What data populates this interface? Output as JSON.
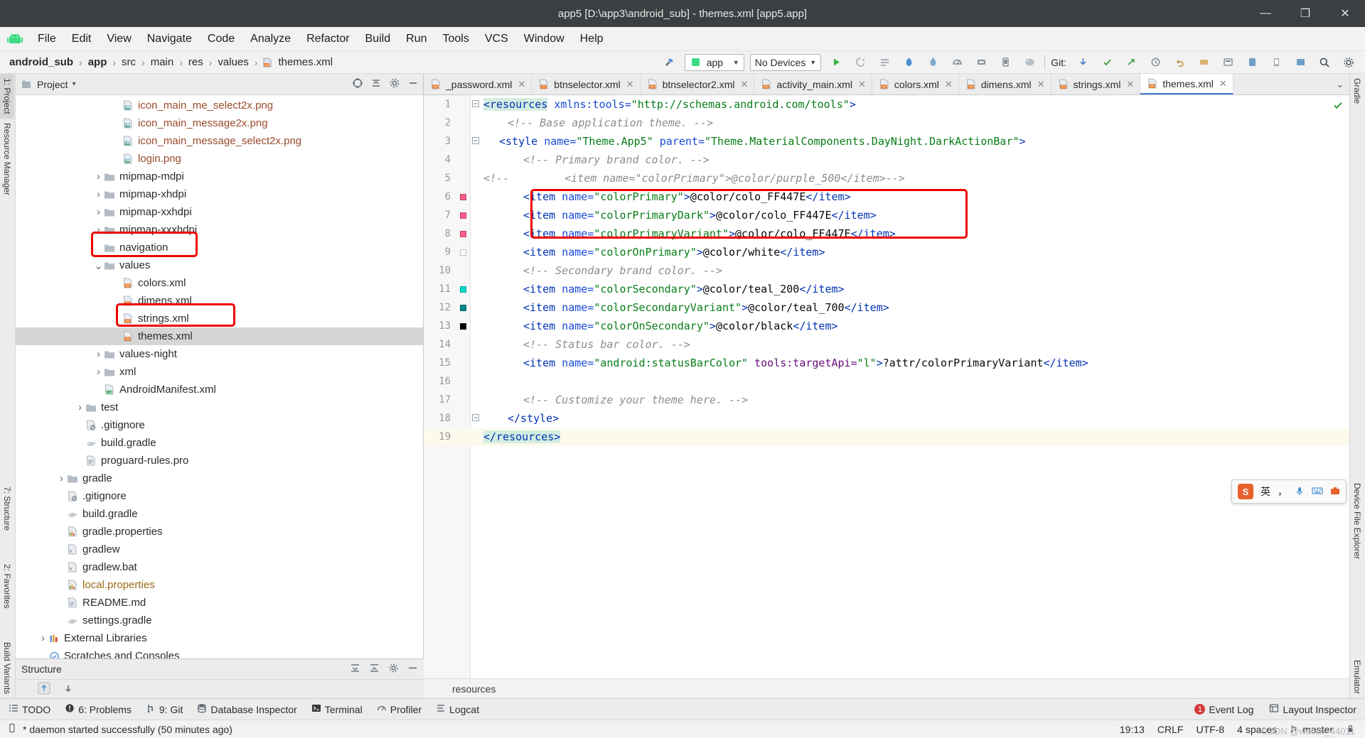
{
  "window": {
    "title": "app5 [D:\\app3\\android_sub] - themes.xml [app5.app]",
    "minimize": "—",
    "maximize": "❐",
    "close": "✕"
  },
  "menubar": {
    "logo": "android-logo-icon",
    "items": [
      "File",
      "Edit",
      "View",
      "Navigate",
      "Code",
      "Analyze",
      "Refactor",
      "Build",
      "Run",
      "Tools",
      "VCS",
      "Window",
      "Help"
    ]
  },
  "navbar": {
    "crumbs": [
      "android_sub",
      "app",
      "src",
      "main",
      "res",
      "values",
      "themes.xml"
    ],
    "separator": "›",
    "module_selector": "app",
    "device_selector": "No Devices",
    "git_label": "Git:",
    "run_icon": "run-icon",
    "debug_icon": "debug-icon",
    "search_icon": "search-icon"
  },
  "left_rail": {
    "items": [
      "1: Project",
      "Resource Manager"
    ],
    "bottom_items": [
      "7: Structure",
      "2: Favorites",
      "Build Variants"
    ]
  },
  "right_rail": {
    "items": [
      "Gradle",
      "Device File Explorer",
      "Emulator"
    ]
  },
  "project_panel": {
    "title": "Project",
    "caret": "▾",
    "icons": [
      "target-icon",
      "collapse-all-icon",
      "settings-icon",
      "hide-icon"
    ],
    "tree": [
      {
        "indent": 5,
        "arrow": "",
        "icon": "png-file-icon",
        "label": "icon_main_me_select2x.png",
        "style": "png",
        "selected": false
      },
      {
        "indent": 5,
        "arrow": "",
        "icon": "png-file-icon",
        "label": "icon_main_message2x.png",
        "style": "png",
        "selected": false
      },
      {
        "indent": 5,
        "arrow": "",
        "icon": "png-file-icon",
        "label": "icon_main_message_select2x.png",
        "style": "png",
        "selected": false
      },
      {
        "indent": 5,
        "arrow": "",
        "icon": "png-file-icon",
        "label": "login.png",
        "style": "png",
        "selected": false
      },
      {
        "indent": 4,
        "arrow": "›",
        "icon": "folder-icon",
        "label": "mipmap-mdpi",
        "style": "",
        "selected": false
      },
      {
        "indent": 4,
        "arrow": "›",
        "icon": "folder-icon",
        "label": "mipmap-xhdpi",
        "style": "",
        "selected": false
      },
      {
        "indent": 4,
        "arrow": "›",
        "icon": "folder-icon",
        "label": "mipmap-xxhdpi",
        "style": "",
        "selected": false
      },
      {
        "indent": 4,
        "arrow": "›",
        "icon": "folder-icon",
        "label": "mipmap-xxxhdpi",
        "style": "",
        "selected": false
      },
      {
        "indent": 4,
        "arrow": "",
        "icon": "folder-icon",
        "label": "navigation",
        "style": "",
        "selected": false
      },
      {
        "indent": 4,
        "arrow": "∨",
        "icon": "folder-icon",
        "label": "values",
        "style": "",
        "selected": false
      },
      {
        "indent": 5,
        "arrow": "",
        "icon": "xml-file-icon",
        "label": "colors.xml",
        "style": "",
        "selected": false
      },
      {
        "indent": 5,
        "arrow": "",
        "icon": "xml-file-icon",
        "label": "dimens.xml",
        "style": "",
        "selected": false
      },
      {
        "indent": 5,
        "arrow": "",
        "icon": "xml-file-icon",
        "label": "strings.xml",
        "style": "",
        "selected": false
      },
      {
        "indent": 5,
        "arrow": "",
        "icon": "xml-file-icon",
        "label": "themes.xml",
        "style": "",
        "selected": true
      },
      {
        "indent": 4,
        "arrow": "›",
        "icon": "folder-icon",
        "label": "values-night",
        "style": "",
        "selected": false
      },
      {
        "indent": 4,
        "arrow": "›",
        "icon": "folder-icon",
        "label": "xml",
        "style": "",
        "selected": false
      },
      {
        "indent": 4,
        "arrow": "",
        "icon": "manifest-file-icon",
        "label": "AndroidManifest.xml",
        "style": "",
        "selected": false
      },
      {
        "indent": 3,
        "arrow": "›",
        "icon": "folder-icon",
        "label": "test",
        "style": "",
        "selected": false
      },
      {
        "indent": 3,
        "arrow": "",
        "icon": "gitignore-icon",
        "label": ".gitignore",
        "style": "",
        "selected": false
      },
      {
        "indent": 3,
        "arrow": "",
        "icon": "gradle-file-icon",
        "label": "build.gradle",
        "style": "",
        "selected": false
      },
      {
        "indent": 3,
        "arrow": "",
        "icon": "pro-file-icon",
        "label": "proguard-rules.pro",
        "style": "",
        "selected": false
      },
      {
        "indent": 2,
        "arrow": "›",
        "icon": "folder-icon",
        "label": "gradle",
        "style": "",
        "selected": false
      },
      {
        "indent": 2,
        "arrow": "",
        "icon": "gitignore-icon",
        "label": ".gitignore",
        "style": "",
        "selected": false
      },
      {
        "indent": 2,
        "arrow": "",
        "icon": "gradle-file-icon",
        "label": "build.gradle",
        "style": "",
        "selected": false
      },
      {
        "indent": 2,
        "arrow": "",
        "icon": "properties-icon",
        "label": "gradle.properties",
        "style": "",
        "selected": false
      },
      {
        "indent": 2,
        "arrow": "",
        "icon": "script-file-icon",
        "label": "gradlew",
        "style": "",
        "selected": false
      },
      {
        "indent": 2,
        "arrow": "",
        "icon": "script-file-icon",
        "label": "gradlew.bat",
        "style": "",
        "selected": false
      },
      {
        "indent": 2,
        "arrow": "",
        "icon": "properties-icon",
        "label": "local.properties",
        "style": "prop",
        "selected": false
      },
      {
        "indent": 2,
        "arrow": "",
        "icon": "md-file-icon",
        "label": "README.md",
        "style": "",
        "selected": false
      },
      {
        "indent": 2,
        "arrow": "",
        "icon": "gradle-file-icon",
        "label": "settings.gradle",
        "style": "",
        "selected": false
      },
      {
        "indent": 1,
        "arrow": "›",
        "icon": "library-icon",
        "label": "External Libraries",
        "style": "",
        "selected": false
      },
      {
        "indent": 1,
        "arrow": "",
        "icon": "scratch-icon",
        "label": "Scratches and Consoles",
        "style": "",
        "selected": false
      }
    ]
  },
  "structure_panel": {
    "title": "Structure",
    "icons": [
      "expand-all-icon",
      "collapse-all-icon",
      "settings-icon",
      "hide-icon"
    ],
    "body_icons": [
      "sort-up-icon",
      "sort-down-icon"
    ]
  },
  "editor": {
    "tabs": [
      {
        "label": "_password.xml",
        "active": false
      },
      {
        "label": "btnselector.xml",
        "active": false
      },
      {
        "label": "btnselector2.xml",
        "active": false
      },
      {
        "label": "activity_main.xml",
        "active": false
      },
      {
        "label": "colors.xml",
        "active": false
      },
      {
        "label": "dimens.xml",
        "active": false
      },
      {
        "label": "strings.xml",
        "active": false
      },
      {
        "label": "themes.xml",
        "active": true
      }
    ],
    "tab_close": "✕",
    "tabs_overflow": "⌄",
    "breadcrumb_bottom": "resources",
    "inspection_ok": "✓",
    "lines": [
      {
        "n": 1,
        "marker": "",
        "fold": "−",
        "highlight": false
      },
      {
        "n": 2,
        "marker": "",
        "fold": "",
        "highlight": false
      },
      {
        "n": 3,
        "marker": "",
        "fold": "−",
        "highlight": false
      },
      {
        "n": 4,
        "marker": "",
        "fold": "",
        "highlight": false
      },
      {
        "n": 5,
        "marker": "",
        "fold": "",
        "highlight": false
      },
      {
        "n": 6,
        "marker": "#ff5c8a",
        "fold": "",
        "highlight": false
      },
      {
        "n": 7,
        "marker": "#ff5c8a",
        "fold": "",
        "highlight": false
      },
      {
        "n": 8,
        "marker": "#ff5c8a",
        "fold": "",
        "highlight": false
      },
      {
        "n": 9,
        "marker": "#ffffff",
        "fold": "",
        "highlight": false
      },
      {
        "n": 10,
        "marker": "",
        "fold": "",
        "highlight": false
      },
      {
        "n": 11,
        "marker": "#03dac5",
        "fold": "",
        "highlight": false
      },
      {
        "n": 12,
        "marker": "#018786",
        "fold": "",
        "highlight": false
      },
      {
        "n": 13,
        "marker": "#000000",
        "fold": "",
        "highlight": false
      },
      {
        "n": 14,
        "marker": "",
        "fold": "",
        "highlight": false
      },
      {
        "n": 15,
        "marker": "",
        "fold": "",
        "highlight": false
      },
      {
        "n": 16,
        "marker": "",
        "fold": "",
        "highlight": false
      },
      {
        "n": 17,
        "marker": "",
        "fold": "",
        "highlight": false
      },
      {
        "n": 18,
        "marker": "",
        "fold": "−",
        "highlight": false
      },
      {
        "n": 19,
        "marker": "",
        "fold": "",
        "highlight": true
      }
    ],
    "code_text": {
      "l1": "<resources xmlns:tools=\"http://schemas.android.com/tools\">",
      "l2": "<!-- Base application theme. -->",
      "l3": "<style name=\"Theme.App5\" parent=\"Theme.MaterialComponents.DayNight.DarkActionBar\">",
      "l4": "<!-- Primary brand color. -->",
      "l5": "<!--        <item name=\"colorPrimary\">@color/purple_500</item>-->",
      "l6": "<item name=\"colorPrimary\">@color/colo_FF447E</item>",
      "l7": "<item name=\"colorPrimaryDark\">@color/colo_FF447E</item>",
      "l8": "<item name=\"colorPrimaryVariant\">@color/colo_FF447E</item>",
      "l9": "<item name=\"colorOnPrimary\">@color/white</item>",
      "l10": "<!-- Secondary brand color. -->",
      "l11": "<item name=\"colorSecondary\">@color/teal_200</item>",
      "l12": "<item name=\"colorSecondaryVariant\">@color/teal_700</item>",
      "l13": "<item name=\"colorOnSecondary\">@color/black</item>",
      "l14": "<!-- Status bar color. -->",
      "l15": "<item name=\"android:statusBarColor\" tools:targetApi=\"l\">?attr/colorPrimaryVariant</item>",
      "l17": "<!-- Customize your theme here. -->",
      "l18": "</style>",
      "l19": "</resources>"
    }
  },
  "bottom_bar": {
    "items": [
      {
        "icon": "todo-icon",
        "label": "TODO"
      },
      {
        "icon": "problems-icon",
        "label": "6: Problems"
      },
      {
        "icon": "git-icon",
        "label": "9: Git"
      },
      {
        "icon": "database-icon",
        "label": "Database Inspector"
      },
      {
        "icon": "terminal-icon",
        "label": "Terminal"
      },
      {
        "icon": "profiler-icon",
        "label": "Profiler"
      },
      {
        "icon": "logcat-icon",
        "label": "Logcat"
      }
    ],
    "right": [
      {
        "icon": "event-log-icon",
        "label": "Event Log",
        "badge": "1"
      },
      {
        "icon": "layout-inspector-icon",
        "label": "Layout Inspector",
        "badge": ""
      }
    ]
  },
  "status_bar": {
    "message": "* daemon started successfully (50 minutes ago)",
    "message_icon": "device-icon",
    "right": [
      {
        "label": "19:13"
      },
      {
        "label": "CRLF"
      },
      {
        "label": "UTF-8"
      },
      {
        "label": "4 spaces"
      },
      {
        "label": "master",
        "icon": "branch-icon"
      }
    ],
    "lock_icon": "lock-icon"
  },
  "ime_widget": {
    "logo": "S",
    "mode": "英",
    "icons": [
      "comma-icon",
      "mic-icon",
      "keyboard-icon",
      "toolbox-icon"
    ]
  },
  "watermark": "CSDN @weixin_44011",
  "colors": {
    "red_highlight": "#ee0000",
    "accent_blue": "#3c7fd4",
    "tag": "#0033b3",
    "attr_value": "#067d17",
    "comment": "#8c8c8c",
    "namespace": "#660e7a"
  }
}
